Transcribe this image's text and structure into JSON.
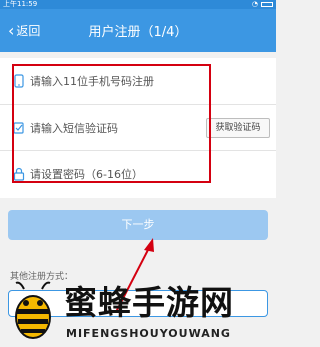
{
  "status_bar": {
    "time": "上午11:59"
  },
  "nav": {
    "back_label": "返回",
    "title": "用户注册（1/4）"
  },
  "form": {
    "phone_placeholder": "请输入11位手机号码注册",
    "sms_placeholder": "请输入短信验证码",
    "get_code_label": "获取验证码",
    "password_placeholder": "请设置密码（6-16位）"
  },
  "next_label": "下一步",
  "other_register": {
    "label": "其他注册方式："
  },
  "watermark": {
    "title": "蜜蜂手游网",
    "subtitle": "MIFENGSHOUYOUWANG"
  },
  "colors": {
    "primary": "#3c97e3",
    "next_disabled": "#9cc8f1",
    "annotation": "#d40010"
  }
}
